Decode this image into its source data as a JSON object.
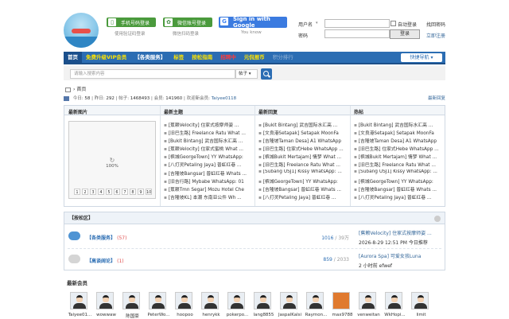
{
  "header": {
    "phone_login": "手机号码登录",
    "phone_sub": "使用验证码登录",
    "wechat_login": "微信账号登录",
    "wechat_sub": "微信扫码登录",
    "google_login": "Sign in with Google",
    "google_sub": "You know",
    "username_label": "用户名",
    "password_label": "密码",
    "auto_login": "自动登录",
    "find_password": "找回密码",
    "submit": "登录",
    "register": "立即注册"
  },
  "nav": {
    "items": [
      "首页",
      "免费升级VIP会员",
      "【各类服务】",
      "标签",
      "按松指南",
      "招聘中",
      "元侃报币",
      "积分排行"
    ],
    "quick_nav": "快捷导航"
  },
  "search": {
    "placeholder": "请输入搜索内容",
    "scope": "帖子"
  },
  "breadcrumb": {
    "home": "首页"
  },
  "stats": {
    "today_label": "今日:",
    "today": "58",
    "yesterday_label": "昨日:",
    "yesterday": "292",
    "posts_label": "帖子:",
    "posts": "1468493",
    "members_label": "会员:",
    "members": "141960",
    "welcome_label": "欢迎新会员:",
    "newest_member": "Taiyee0118",
    "newest_reply": "最新回复"
  },
  "quad": {
    "col1": "最新图片",
    "col2": "最新主题",
    "col3": "最新回复",
    "col4": "热帖",
    "loading": "100%",
    "pages": [
      "1",
      "2",
      "3",
      "4",
      "5",
      "6",
      "7",
      "8",
      "9",
      "10"
    ],
    "new_threads": [
      "[蕉赖Velocity] 住家式按摩师姿 ...",
      "[旧巴生路] Freelance Ratu What ...",
      "[Bukit Bintang] 武吉国际水汇高 ...",
      "[蕉赖Velocity] 住家式蜜桃 What ...",
      "[槟城GeorgeTown] YY WhatsApp:",
      "[八打灵Petaling Jaya] 普虹红巷 ...",
      "[吉隆坡Bangsar] 普虹红巷 Whats ...",
      "[旧吉行路] Mybabe WhatsApp: 01",
      "[蕉赖Tmn Segar] Mozu Hotel Che",
      "[吉隆坡KL] 本潮 东南亚公件 Wh ..."
    ],
    "new_replies": [
      "[Bukit Bintang] 武吉国际水汇高 ...",
      "[文良港Setapak] Setapak MoonFa",
      "[吉隆坡Taman Desa] A1 WhatsApp",
      "[旧巴生路] 住家式Hebe WhatsApp ...",
      "[槟城Bukit Mertajam] 情梦 What ...",
      "[旧巴生路] Freelance Ratu What ...",
      "[Subang USJ1] Kissy WhatsApp: ...",
      "[槟城GeorgeTown] YY WhatsApp:",
      "[吉隆坡Bangsar] 普虹红巷 Whats ...",
      "[八打灵Petaling Jaya] 普虹红巷 ..."
    ],
    "hot_threads": [
      "[Bukit Bintang] 武吉国际水汇高 ...",
      "[文良港Setapak] Setapak MoonFa",
      "[吉隆坡Taman Desa] A1 WhatsApp",
      "[旧巴生路] 住家式Hebe WhatsApp ...",
      "[槟城Bukit Mertajam] 情梦 What ...",
      "[旧巴生路] Freelance Ratu What ...",
      "[Subang USJ1] Kissy WhatsApp: ...",
      "[槟城GeorgeTown] YY WhatsApp:",
      "[吉隆坡Bangsar] 普虹红巷 Whats ...",
      "[八打灵Petaling Jaya] 普虹红巷 ..."
    ]
  },
  "forum": {
    "section": "【按松区】",
    "rows": [
      {
        "name": "【各类服务】",
        "count": "(57)",
        "threads": "1016",
        "posts": "/ 39万",
        "last_title": "[蕉赖Velocity] 住家式按摩师姿 ...",
        "last_meta": "2026-8-29 12:51 PM 今日推荐"
      },
      {
        "name": "【高谈阔论】",
        "count": "(1)",
        "threads": "859",
        "posts": "/ 2033",
        "last_title": "[Aurora Spa] 可爱女孩Luna",
        "last_meta": "2 小时前 efwef"
      }
    ]
  },
  "members": {
    "title": "最新会员",
    "names": [
      "Taiyee01...",
      "wowwaw",
      "陈国豪",
      "PeterWo...",
      "hoopoo",
      "henrykk",
      "pokerpo...",
      "lang8855",
      "JaspalKalsi",
      "Raymon...",
      "max9788",
      "venweitan",
      "WkHopi...",
      "limit"
    ]
  }
}
